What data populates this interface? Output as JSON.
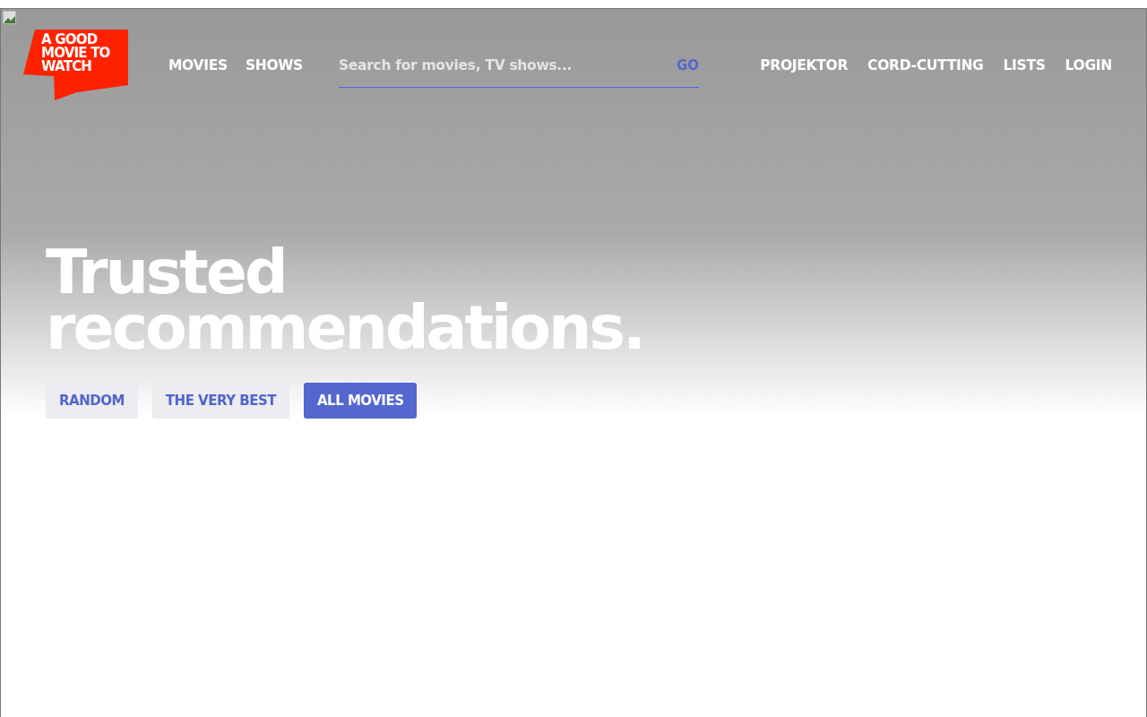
{
  "logo": {
    "lines": [
      "A GOOD",
      "MOVIE TO",
      "WATCH"
    ]
  },
  "nav_left": [
    "MOVIES",
    "SHOWS"
  ],
  "search": {
    "placeholder": "Search for movies, TV shows...",
    "button": "GO"
  },
  "nav_right": [
    "PROJEKTOR",
    "CORD-CUTTING",
    "LISTS",
    "LOGIN"
  ],
  "hero": {
    "title": "Trusted recommendations."
  },
  "filters": [
    {
      "label": "RANDOM",
      "selected": false
    },
    {
      "label": "THE VERY BEST",
      "selected": false
    },
    {
      "label": "ALL MOVIES",
      "selected": true
    }
  ]
}
